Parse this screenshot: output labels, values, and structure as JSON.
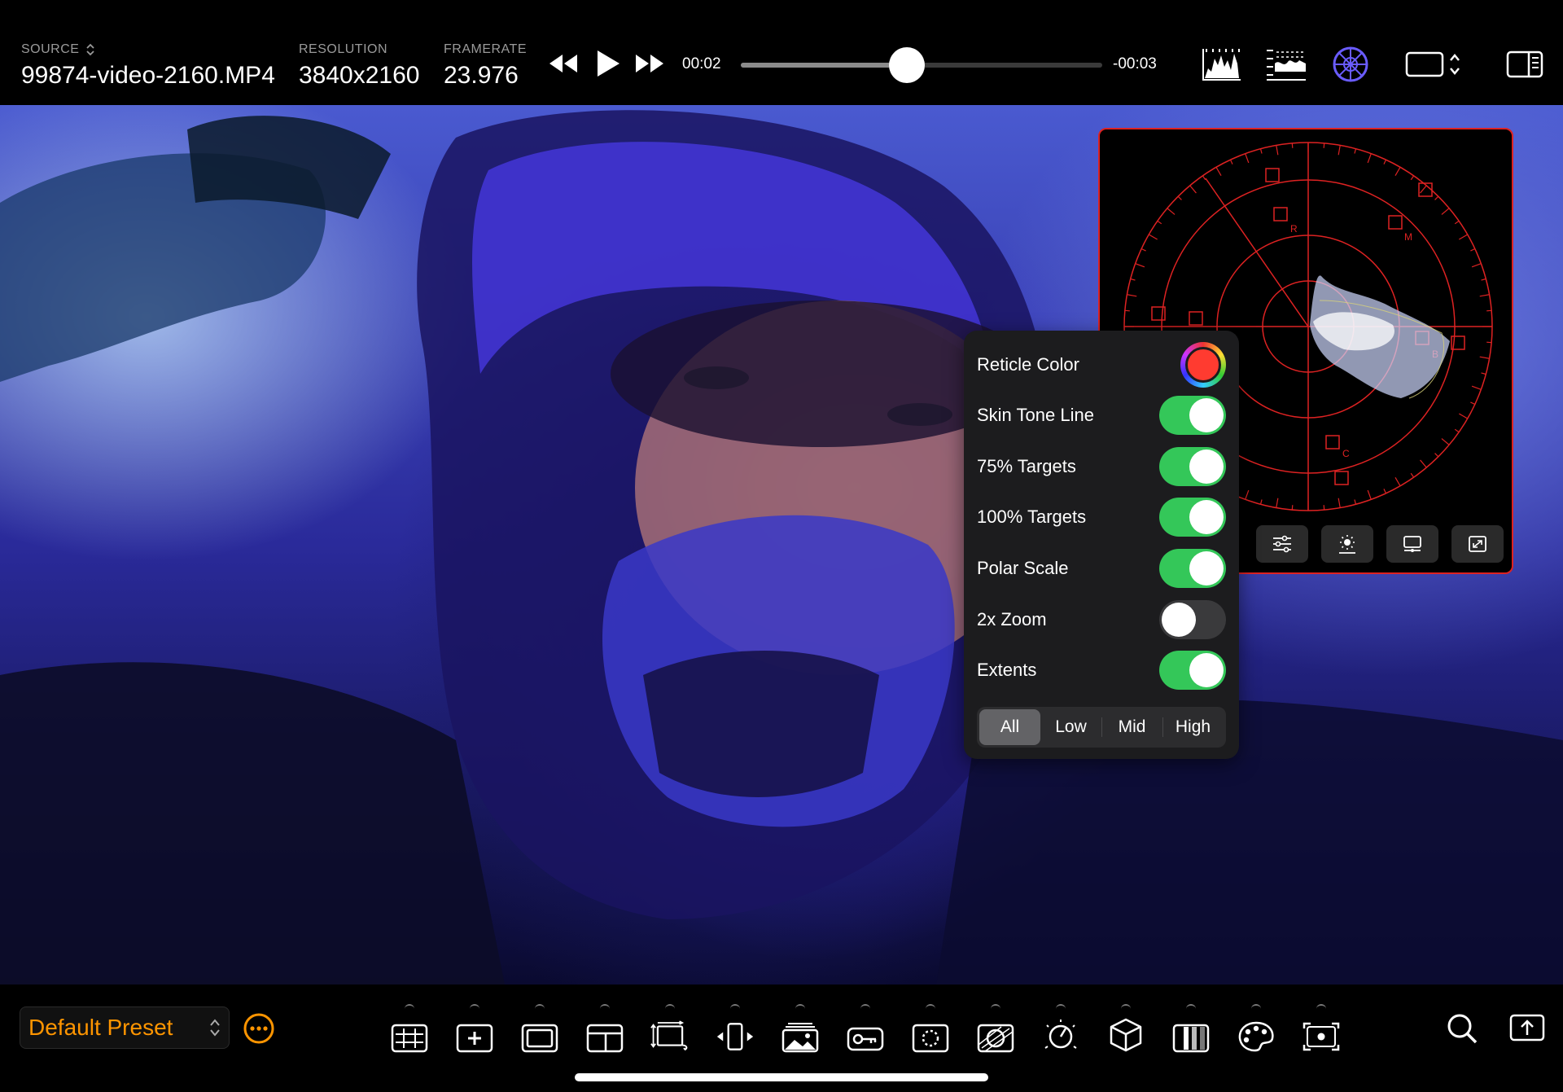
{
  "header": {
    "source_label": "SOURCE",
    "source_value": "99874-video-2160.MP4",
    "resolution_label": "RESOLUTION",
    "resolution_value": "3840x2160",
    "framerate_label": "FRAMERATE",
    "framerate_value": "23.976",
    "elapsed": "00:02",
    "remaining": "-00:03",
    "playback_progress": 0.46
  },
  "scope": {
    "type": "vectorscope",
    "reticle_color": "#ff3b30",
    "target_labels": [
      "R",
      "M",
      "B",
      "C"
    ],
    "buttons": [
      "settings-sliders-icon",
      "brightness-icon",
      "display-icon",
      "expand-icon"
    ]
  },
  "settings_panel": {
    "rows": [
      {
        "label": "Reticle Color",
        "kind": "color",
        "value": "#ff3b30"
      },
      {
        "label": "Skin Tone Line",
        "kind": "toggle",
        "on": true
      },
      {
        "label": "75% Targets",
        "kind": "toggle",
        "on": true
      },
      {
        "label": "100% Targets",
        "kind": "toggle",
        "on": true
      },
      {
        "label": "Polar Scale",
        "kind": "toggle",
        "on": true
      },
      {
        "label": "2x Zoom",
        "kind": "toggle",
        "on": false
      },
      {
        "label": "Extents",
        "kind": "toggle",
        "on": true
      }
    ],
    "segments": [
      "All",
      "Low",
      "Mid",
      "High"
    ],
    "selected_segment": "All"
  },
  "footer": {
    "preset": "Default Preset",
    "tools": [
      "grid-icon",
      "crosshair-add-icon",
      "frame-guide-icon",
      "layout-icon",
      "transform-icon",
      "flip-icon",
      "image-overlay-icon",
      "key-icon",
      "focus-peaking-icon",
      "false-color-icon",
      "exposure-icon",
      "lut-cube-icon",
      "zebra-icon",
      "color-palette-icon",
      "spot-meter-icon"
    ]
  },
  "colors": {
    "accent_orange": "#ff9500",
    "toggle_green": "#34c759",
    "scope_red": "#dd2222"
  }
}
